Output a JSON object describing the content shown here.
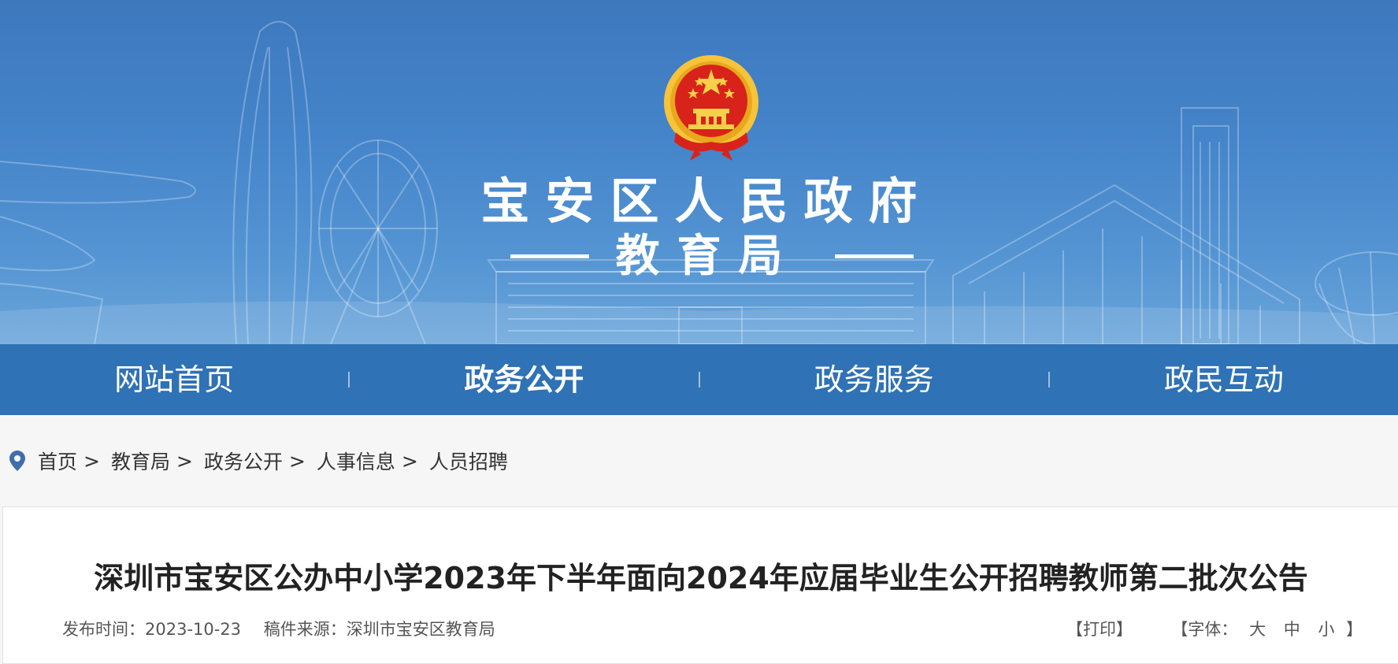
{
  "header": {
    "site_title": "宝安区人民政府",
    "sub_title": "教育局"
  },
  "nav": {
    "items": [
      {
        "label": "网站首页"
      },
      {
        "label": "政务公开"
      },
      {
        "label": "政务服务"
      },
      {
        "label": "政民互动"
      }
    ],
    "active_index": 1
  },
  "breadcrumb": {
    "items": [
      "首页",
      "教育局",
      "政务公开",
      "人事信息",
      "人员招聘"
    ],
    "separator": ">"
  },
  "article": {
    "title": "深圳市宝安区公办中小学2023年下半年面向2024年应届毕业生公开招聘教师第二批次公告",
    "publish_label": "发布时间：",
    "publish_date": "2023-10-23",
    "source_label": "稿件来源：",
    "source": "深圳市宝安区教育局"
  },
  "tools": {
    "print_label": "【打印】",
    "font_open": "【字体：",
    "font_large": "大",
    "font_medium": "中",
    "font_small": "小",
    "font_close": "】"
  },
  "colors": {
    "nav_bg": "#2f72b5",
    "banner_top": "#3d78bd",
    "emblem_red": "#d8231a",
    "emblem_gold": "#f6c33a"
  }
}
